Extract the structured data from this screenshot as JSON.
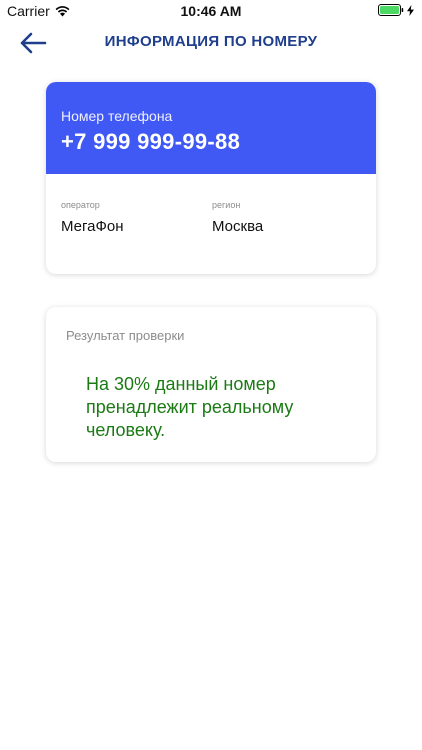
{
  "status_bar": {
    "carrier": "Carrier",
    "time": "10:46 AM",
    "icons": [
      "wifi-icon",
      "battery-icon",
      "charging-bolt-icon"
    ]
  },
  "header": {
    "back_icon": "arrow-left-icon",
    "title": "ИНФОРМАЦИЯ ПО НОМЕРУ"
  },
  "phone_card": {
    "label": "Номер телефона",
    "number": "+7 999 999-99-88",
    "operator_label": "оператор",
    "operator_value": "МегаФон",
    "region_label": "регион",
    "region_value": "Москва"
  },
  "result_card": {
    "title": "Результат проверки",
    "text": "На 30% данный номер пренадлежит реальному человеку."
  },
  "colors": {
    "accent": "#4058f4",
    "title": "#1f3f8c",
    "result_text": "#1c7a15",
    "muted": "#8c8c8c",
    "battery": "#4cd964"
  }
}
